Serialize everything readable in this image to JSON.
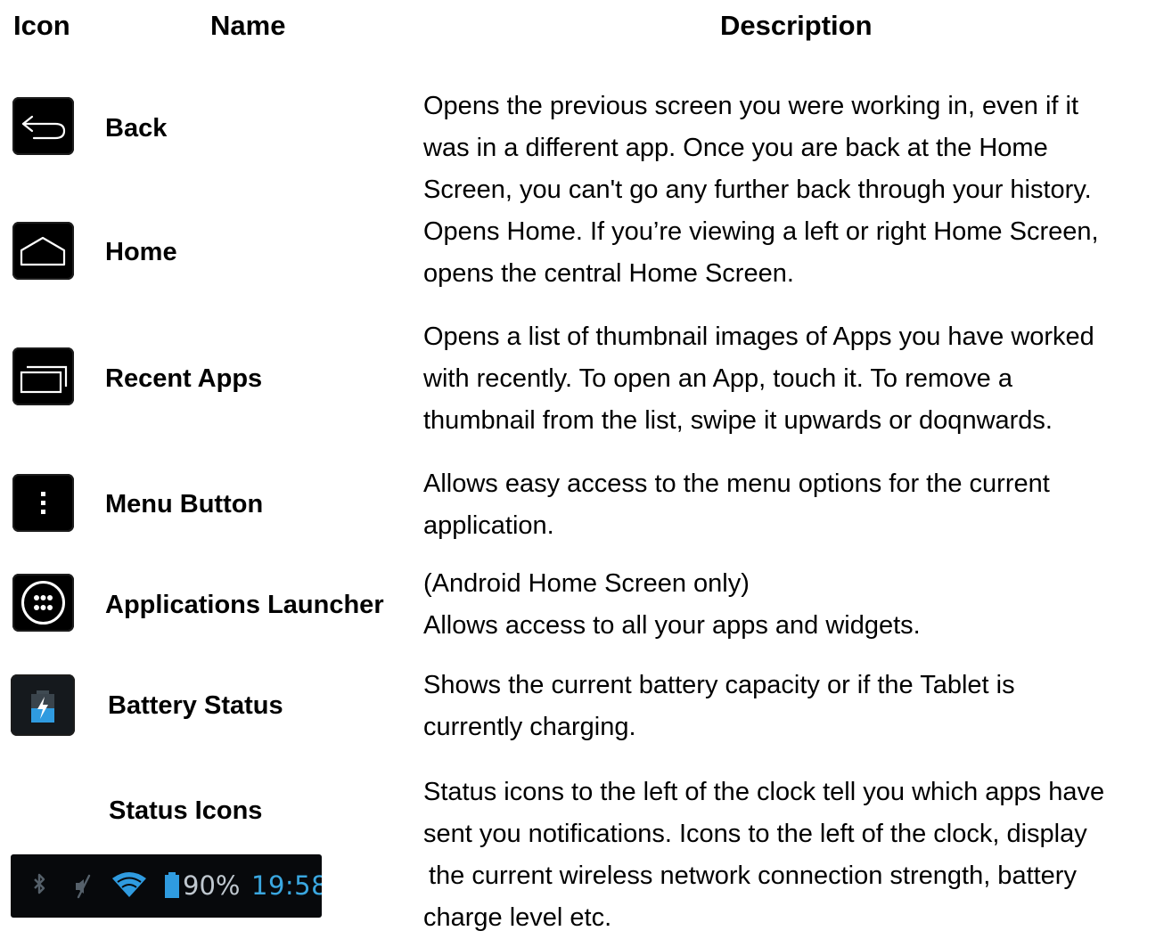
{
  "header": {
    "icon": "Icon",
    "name": "Name",
    "description": "Description"
  },
  "rows": [
    {
      "icon": "back-arrow-icon",
      "name": "Back",
      "description": [
        "Opens the previous screen you were working in, even if it",
        "was in a different app. Once you are back at the Home",
        "Screen, you can't go any further back through your history."
      ]
    },
    {
      "icon": "home-icon",
      "name": "Home",
      "description": [
        "Opens Home. If you’re viewing a left or right Home Screen,",
        "opens the central Home Screen."
      ]
    },
    {
      "icon": "recent-apps-icon",
      "name": "Recent Apps",
      "description": [
        "Opens a list of thumbnail images of Apps you have worked",
        "with recently. To open an App, touch it. To remove a",
        "thumbnail from the list, swipe it upwards or doqnwards."
      ]
    },
    {
      "icon": "menu-dots-icon",
      "name": "Menu Button",
      "description": [
        "Allows easy access to the menu options for the current",
        "application."
      ]
    },
    {
      "icon": "apps-grid-icon",
      "name": "Applications Launcher",
      "description": [
        "(Android Home Screen only)",
        "Allows access to all your apps and widgets."
      ]
    },
    {
      "icon": "battery-charging-icon",
      "name": "Battery Status",
      "description": [
        "Shows the current battery capacity or if the Tablet is",
        "currently charging."
      ]
    },
    {
      "icon": "status-bar-image",
      "name": "Status Icons",
      "description": [
        "Status icons to the left of the clock tell you which apps have",
        "sent you notifications. Icons to the left of the clock, display",
        "the current wireless network connection strength, battery",
        "charge level etc."
      ]
    }
  ],
  "status_bar": {
    "battery_percent": "90%",
    "time": "19:58",
    "icons": [
      "bluetooth-icon",
      "mute-icon",
      "wifi-icon",
      "battery-icon"
    ],
    "time_color": "#3aa7e0"
  }
}
